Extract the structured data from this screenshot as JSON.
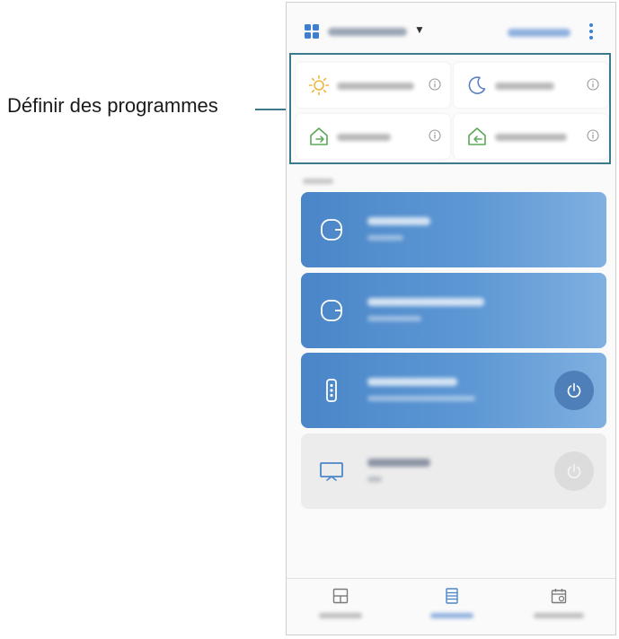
{
  "annotation": {
    "label": "Définir des programmes",
    "color": "#3a7a8c"
  },
  "header": {
    "location_icon": "grid-icon",
    "dropdown_icon": "caret-down-icon",
    "more_icon": "more-vertical-icon"
  },
  "scenes": {
    "items": [
      {
        "icon": "sun-icon",
        "icon_color": "#f0b63a",
        "info_icon": "info-icon"
      },
      {
        "icon": "moon-icon",
        "icon_color": "#5b7fc4",
        "info_icon": "info-icon"
      },
      {
        "icon": "house-arrow-out-icon",
        "icon_color": "#5aa85a",
        "info_icon": "info-icon"
      },
      {
        "icon": "house-arrow-in-icon",
        "icon_color": "#5aa85a",
        "info_icon": "info-icon"
      }
    ]
  },
  "devices": {
    "items": [
      {
        "icon": "hub-icon",
        "style": "blue",
        "has_power": false
      },
      {
        "icon": "hub-icon",
        "style": "blue",
        "has_power": false
      },
      {
        "icon": "remote-icon",
        "style": "blue",
        "has_power": true
      },
      {
        "icon": "tv-icon",
        "style": "grey",
        "has_power": true
      }
    ]
  },
  "bottom_nav": {
    "items": [
      {
        "icon": "dashboard-icon",
        "active": false
      },
      {
        "icon": "devices-icon",
        "active": true
      },
      {
        "icon": "automations-icon",
        "active": false
      }
    ]
  },
  "colors": {
    "accent": "#4a86c8",
    "card_blue": "#5d97d4",
    "card_grey": "#ececec"
  }
}
